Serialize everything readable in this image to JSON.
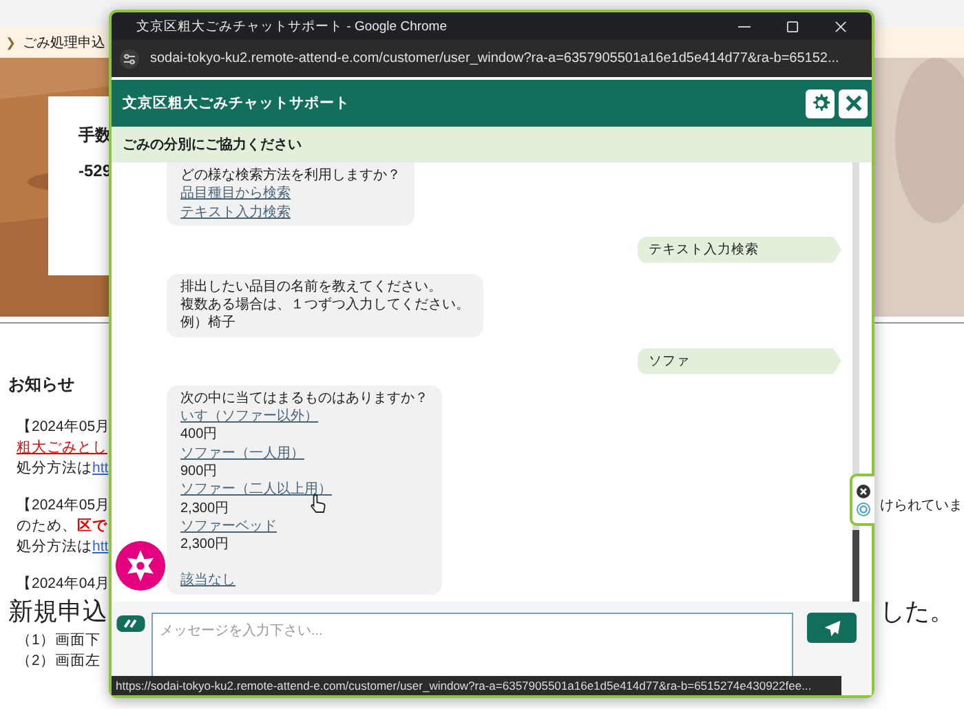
{
  "page": {
    "breadcrumb_icon": "❯",
    "breadcrumb": "ごみ処理申込",
    "card_lines": [
      "手数",
      "-529"
    ],
    "notices_title": "お知らせ",
    "notices": [
      {
        "rows": [
          {
            "parts": [
              {
                "text": "【2024年05月",
                "kind": "plain"
              }
            ]
          },
          {
            "parts": [
              {
                "text": "粗大ごみとし",
                "kind": "alert-link"
              }
            ]
          },
          {
            "parts": [
              {
                "text": "処分方法は",
                "kind": "plain"
              },
              {
                "text": "htt",
                "kind": "link"
              }
            ]
          }
        ]
      },
      {
        "rows": [
          {
            "parts": [
              {
                "text": "【2024年05月",
                "kind": "plain"
              }
            ],
            "right": "けられていま"
          },
          {
            "parts": [
              {
                "text": "のため、",
                "kind": "plain"
              },
              {
                "text": "区で",
                "kind": "alert"
              }
            ]
          },
          {
            "parts": [
              {
                "text": "処分方法は",
                "kind": "plain"
              },
              {
                "text": "htt",
                "kind": "link"
              }
            ]
          }
        ]
      },
      {
        "rows": [
          {
            "parts": [
              {
                "text": "【2024年04月",
                "kind": "plain"
              }
            ]
          },
          {
            "parts": [
              {
                "text": "新規申込",
                "kind": "heading"
              }
            ],
            "right": "した。"
          },
          {
            "parts": [
              {
                "text": "（1）画面下",
                "kind": "plain"
              }
            ]
          },
          {
            "parts": [
              {
                "text": "（2）画面左",
                "kind": "plain"
              }
            ]
          }
        ]
      }
    ]
  },
  "window": {
    "title": "文京区粗大ごみチャットサポート - Google Chrome",
    "url": "sodai-tokyo-ku2.remote-attend-e.com/customer/user_window?ra-a=6357905501a16e1d5e414d77&ra-b=65152..."
  },
  "chat": {
    "title": "文京区粗大ごみチャットサポート",
    "notice": "ごみの分別にご協力ください",
    "messages": [
      {
        "kind": "bot",
        "lines": [
          {
            "kind": "text",
            "text": "どの様な検索方法を利用しますか？"
          },
          {
            "kind": "link",
            "text": "品目種目から検索"
          },
          {
            "kind": "link",
            "text": "テキスト入力検索"
          }
        ]
      },
      {
        "kind": "user",
        "text": "テキスト入力検索"
      },
      {
        "kind": "bot",
        "lines": [
          {
            "kind": "text",
            "text": "排出したい品目の名前を教えてください。"
          },
          {
            "kind": "text",
            "text": "複数ある場合は、１つずつ入力してください。"
          },
          {
            "kind": "text",
            "text": "例）椅子"
          }
        ]
      },
      {
        "kind": "user",
        "text": "ソファ"
      },
      {
        "kind": "bot",
        "lines": [
          {
            "kind": "text",
            "text": "次の中に当てはまるものはありますか？"
          },
          {
            "kind": "link",
            "text": "いす（ソファー以外）"
          },
          {
            "kind": "text",
            "text": "400円"
          },
          {
            "kind": "link",
            "text": "ソファー（一人用）"
          },
          {
            "kind": "text",
            "text": "900円"
          },
          {
            "kind": "link",
            "text": "ソファー（二人以上用）"
          },
          {
            "kind": "text",
            "text": "2,300円"
          },
          {
            "kind": "link",
            "text": "ソファーベッド"
          },
          {
            "kind": "text",
            "text": "2,300円"
          },
          {
            "kind": "separate-link",
            "text": "該当なし"
          }
        ]
      }
    ],
    "input": {
      "placeholder": "メッセージを入力下さい..."
    }
  },
  "status_bar": "https://sodai-tokyo-ku2.remote-attend-e.com/customer/user_window?ra-a=6357905501a16e1d5e414d77&ra-b=6515274e430922fee..."
}
